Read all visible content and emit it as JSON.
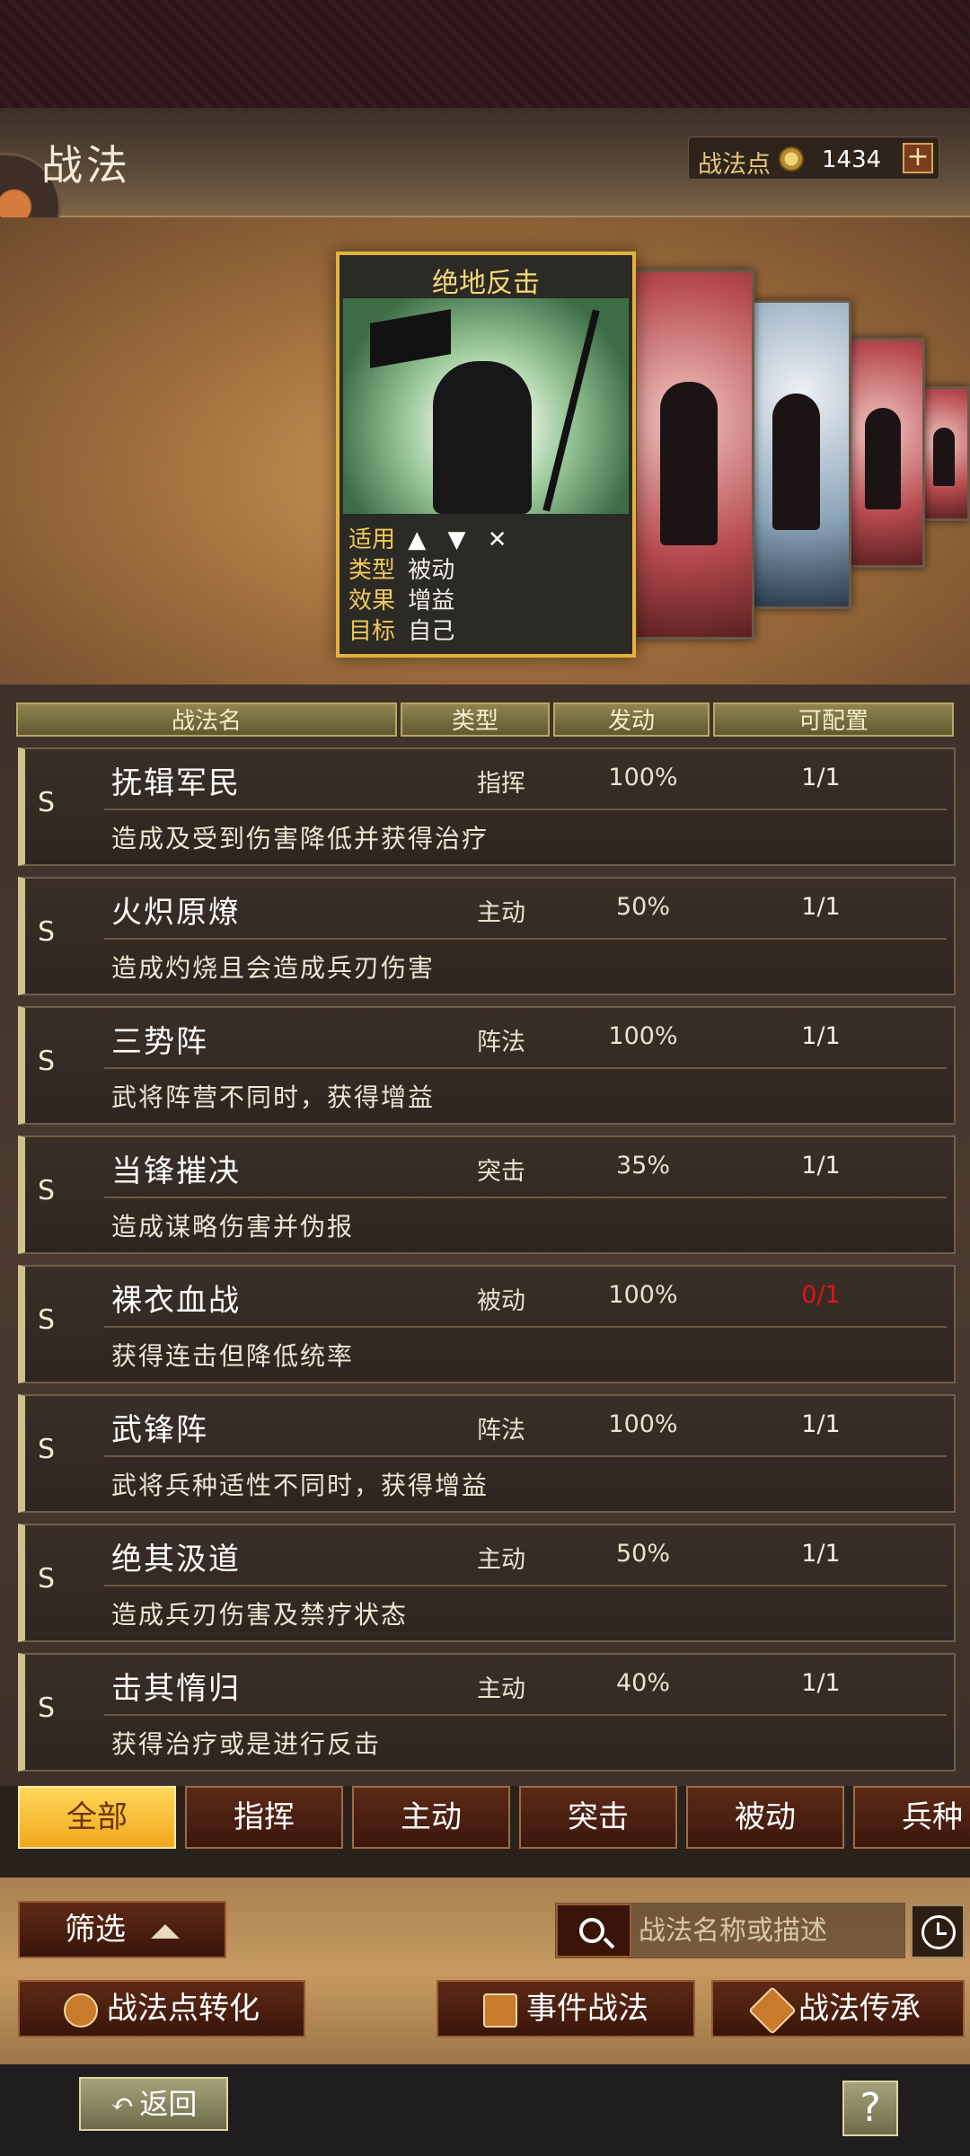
{
  "header": {
    "title": "战法",
    "points_label": "战法点",
    "points_value": "1434",
    "plus_label": "+"
  },
  "card": {
    "name": "绝地反击",
    "apply_label": "适用",
    "apply_icons": "▲ ▼ ✕",
    "type_label": "类型",
    "type_value": "被动",
    "effect_label": "效果",
    "effect_value": "增益",
    "target_label": "目标",
    "target_value": "自己"
  },
  "columns": {
    "name": "战法名",
    "type": "类型",
    "rate": "发动",
    "config": "可配置"
  },
  "rows": [
    {
      "grade": "S",
      "name": "抚辑军民",
      "type": "指挥",
      "rate": "100%",
      "config": "1/1",
      "desc": "造成及受到伤害降低并获得治疗"
    },
    {
      "grade": "S",
      "name": "火炽原燎",
      "type": "主动",
      "rate": "50%",
      "config": "1/1",
      "desc": "造成灼烧且会造成兵刃伤害"
    },
    {
      "grade": "S",
      "name": "三势阵",
      "type": "阵法",
      "rate": "100%",
      "config": "1/1",
      "desc": "武将阵营不同时，获得增益"
    },
    {
      "grade": "S",
      "name": "当锋摧决",
      "type": "突击",
      "rate": "35%",
      "config": "1/1",
      "desc": "造成谋略伤害并伪报"
    },
    {
      "grade": "S",
      "name": "裸衣血战",
      "type": "被动",
      "rate": "100%",
      "config": "0/1",
      "desc": "获得连击但降低统率"
    },
    {
      "grade": "S",
      "name": "武锋阵",
      "type": "阵法",
      "rate": "100%",
      "config": "1/1",
      "desc": "武将兵种适性不同时，获得增益"
    },
    {
      "grade": "S",
      "name": "绝其汲道",
      "type": "主动",
      "rate": "50%",
      "config": "1/1",
      "desc": "造成兵刃伤害及禁疗状态"
    },
    {
      "grade": "S",
      "name": "击其惰归",
      "type": "主动",
      "rate": "40%",
      "config": "1/1",
      "desc": "获得治疗或是进行反击"
    }
  ],
  "tabs": [
    "全部",
    "指挥",
    "主动",
    "突击",
    "被动",
    "兵种"
  ],
  "controls": {
    "filter_label": "筛选",
    "search_placeholder": "战法名称或描述",
    "convert_label": "战法点转化",
    "event_label": "事件战法",
    "inherit_label": "战法传承"
  },
  "footer": {
    "back_label": "返回",
    "help_label": "?"
  },
  "colors": {
    "accent_gold": "#e4b23c",
    "tab_active": "#f1a81d",
    "warning_red": "#e01414"
  }
}
